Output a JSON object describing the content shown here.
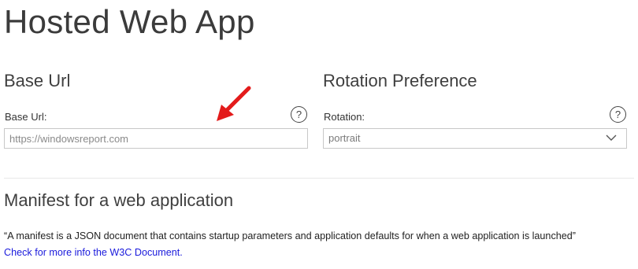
{
  "page": {
    "title": "Hosted Web App"
  },
  "base_url_section": {
    "title": "Base Url",
    "field_label": "Base Url:",
    "help_glyph": "?",
    "input_placeholder": "https://windowsreport.com",
    "input_value": ""
  },
  "rotation_section": {
    "title": "Rotation Preference",
    "field_label": "Rotation:",
    "help_glyph": "?",
    "selected_value": "portrait"
  },
  "manifest_section": {
    "title": "Manifest for a web application",
    "description": "“A manifest is a JSON document that contains startup parameters and application defaults for when a web application is launched”",
    "link_text": "Check for more info the W3C Document."
  },
  "colors": {
    "link": "#1a1adc",
    "annotation_arrow": "#e31b1b",
    "input_border": "#c8c8c8"
  },
  "icons": {
    "help": "help-icon",
    "dropdown": "chevron-down-icon",
    "annotation": "red-arrow-icon"
  }
}
